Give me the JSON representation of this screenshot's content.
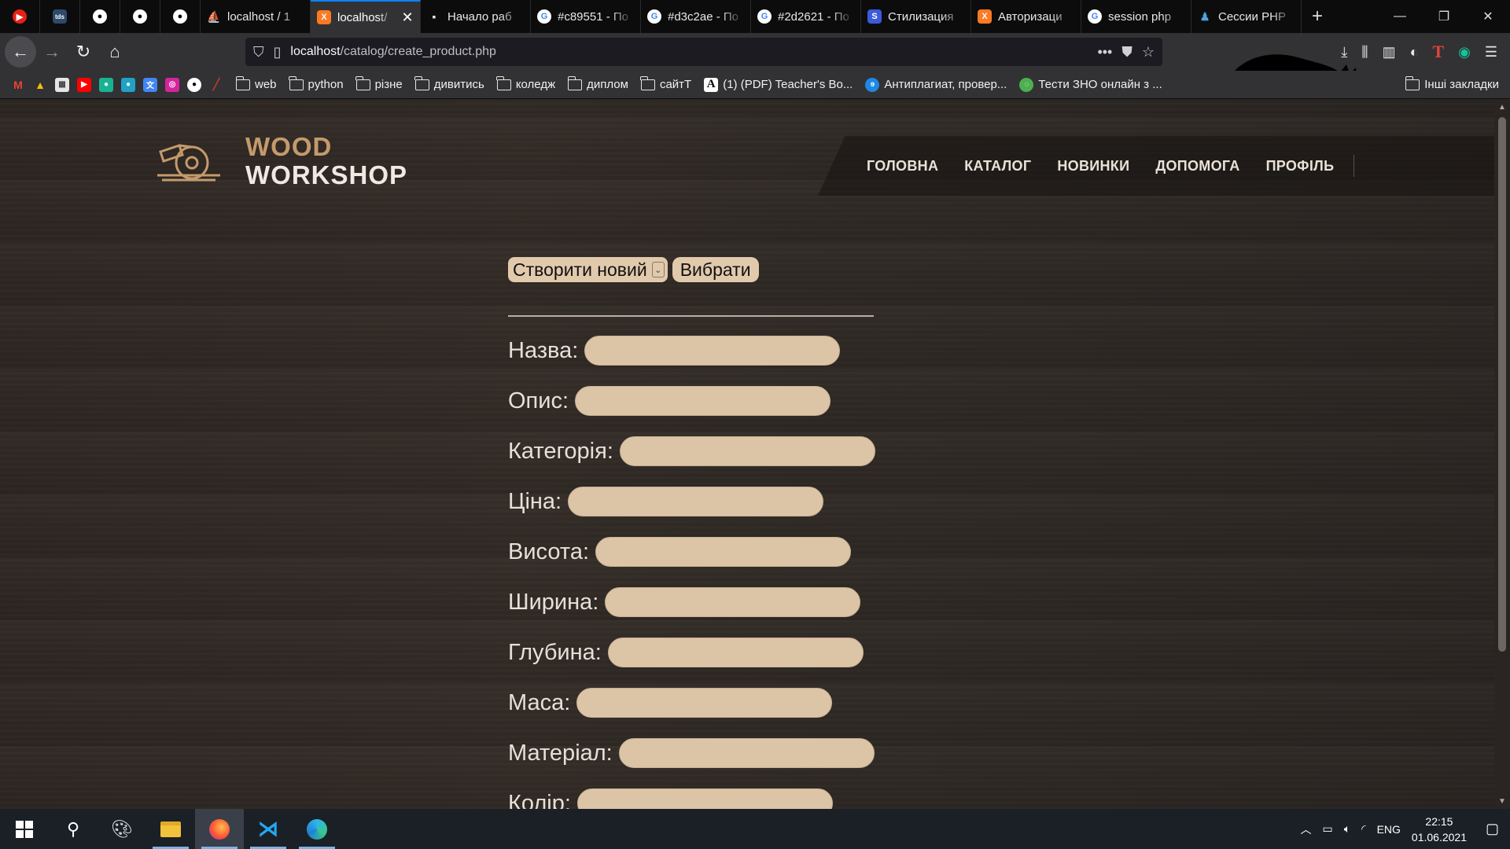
{
  "browser": {
    "tabs": [
      {
        "title": "localhost / 1",
        "favicon": "phpmyadmin-icon",
        "color": "#f29111",
        "active": false
      },
      {
        "title": "localhost/",
        "favicon": "xampp-icon",
        "color": "#fb7a24",
        "active": true
      },
      {
        "title": "Начало раб",
        "favicon": "chat-icon",
        "color": "#e6e6e6",
        "active": false
      },
      {
        "title": "#c89551 - По",
        "favicon": "google-icon",
        "color": "#ffffff",
        "active": false
      },
      {
        "title": "#d3c2ae - По",
        "favicon": "google-icon",
        "color": "#ffffff",
        "active": false
      },
      {
        "title": "#2d2621 - По",
        "favicon": "google-icon",
        "color": "#ffffff",
        "active": false
      },
      {
        "title": "Стилизация",
        "favicon": "s-icon",
        "color": "#3b5bdb",
        "active": false
      },
      {
        "title": "Авторизаци",
        "favicon": "xampp-icon",
        "color": "#fb7a24",
        "active": false
      },
      {
        "title": "session php",
        "favicon": "google-icon",
        "color": "#ffffff",
        "active": false
      },
      {
        "title": "Сессии PHP",
        "favicon": "php-icon",
        "color": "#4aa3df",
        "active": false
      }
    ],
    "pinned_tabs": [
      "youtube-music-icon",
      "tds-icon",
      "github-icon",
      "github-icon",
      "github-icon"
    ],
    "url_host": "localhost",
    "url_path": "/catalog/create_product.php",
    "bookmarks": [
      {
        "type": "folder",
        "label": "web"
      },
      {
        "type": "folder",
        "label": "python"
      },
      {
        "type": "folder",
        "label": "різне"
      },
      {
        "type": "folder",
        "label": "дивитись"
      },
      {
        "type": "folder",
        "label": "коледж"
      },
      {
        "type": "folder",
        "label": "диплом"
      },
      {
        "type": "folder",
        "label": "сайтТ"
      },
      {
        "type": "link",
        "label": "(1) (PDF) Teacher's Bo...",
        "icon": "academia-icon"
      },
      {
        "type": "link",
        "label": "Антиплагиат, провер...",
        "icon": "antiplagiat-icon"
      },
      {
        "type": "link",
        "label": "Тести ЗНО онлайн з ...",
        "icon": "zno-icon"
      }
    ],
    "other_bookmarks": "Інші закладки"
  },
  "site": {
    "logo_line1": "WOOD",
    "logo_line2": "WORKSHOP",
    "nav": [
      "ГОЛОВНА",
      "КАТАЛОГ",
      "НОВИНКИ",
      "ДОПОМОГА",
      "ПРОФІЛЬ"
    ],
    "select_value": "Створити новий",
    "choose_button": "Вибрати",
    "fields": [
      "Назва:",
      "Опис:",
      "Категорія:",
      "Ціна:",
      "Висота:",
      "Ширина:",
      "Глубина:",
      "Маса:",
      "Матеріал:",
      "Колір:"
    ]
  },
  "taskbar": {
    "language": "ENG",
    "time": "22:15",
    "date": "01.06.2021"
  },
  "colors": {
    "accent_wood": "#c49a6c",
    "input_fill": "#dcc4a7",
    "page_bg": "#2b2622"
  }
}
